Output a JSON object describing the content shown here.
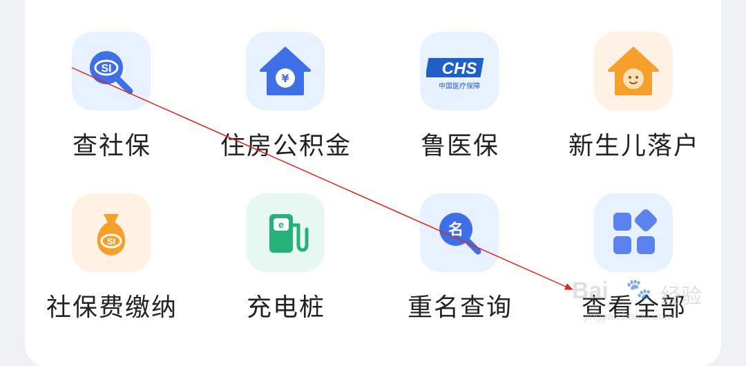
{
  "services": [
    {
      "label": "查社保",
      "icon": "social-security-search-icon",
      "bg": "#e8f1ff",
      "color": "#3f6fe6"
    },
    {
      "label": "住房公积金",
      "icon": "housing-fund-icon",
      "bg": "#e8f1ff",
      "color": "#3f6fe6"
    },
    {
      "label": "鲁医保",
      "icon": "chs-medical-insurance-icon",
      "bg": "#e8f1ff",
      "color": "#1e5fc8",
      "logo_text": "CHS",
      "logo_sub": "中国医疗保障"
    },
    {
      "label": "新生儿落户",
      "icon": "newborn-registration-icon",
      "bg": "#fff1e3",
      "color": "#f5a02a"
    },
    {
      "label": "社保费缴纳",
      "icon": "social-security-payment-icon",
      "bg": "#fff1e3",
      "color": "#f5a02a"
    },
    {
      "label": "充电桩",
      "icon": "charging-pile-icon",
      "bg": "#e6f8f1",
      "color": "#26b07a"
    },
    {
      "label": "重名查询",
      "icon": "duplicate-name-search-icon",
      "bg": "#e8f1ff",
      "color": "#3f6fe6",
      "glyph": "名"
    },
    {
      "label": "查看全部",
      "icon": "view-all-grid-icon",
      "bg": "#e8f1ff",
      "color": "#5b82ee"
    }
  ],
  "annotation": {
    "color": "#e0261d"
  },
  "watermark": {
    "brand": "Bai",
    "cn": "经验",
    "url": "jingyan.baidu.com"
  }
}
